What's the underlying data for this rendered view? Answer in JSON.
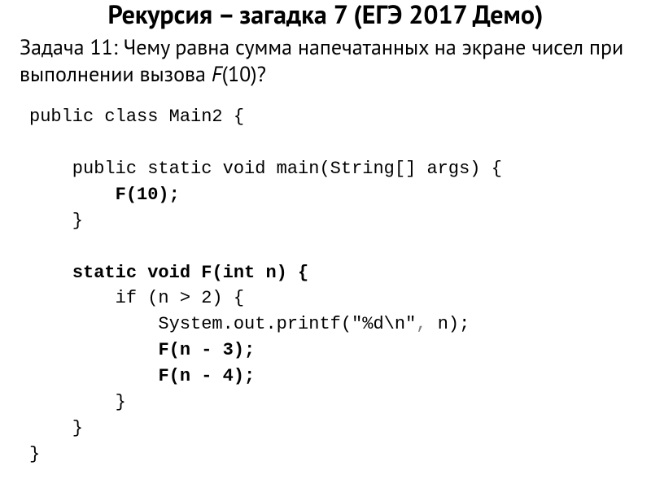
{
  "title": "Рекурсия – загадка 7 (ЕГЭ 2017 Демо)",
  "problem_prefix": "Задача 11: Чему равна сумма напечатанных на экране чисел при выполнении вызова ",
  "problem_fn": "F",
  "problem_suffix": "(10)?",
  "code": {
    "l1": "public class Main2 {",
    "l2": "",
    "l3": "    public static void main(String[] args) {",
    "l4_indent": "        ",
    "l4_bold": "F(10);",
    "l5": "    }",
    "l6": "",
    "l7_indent": "    ",
    "l7_bold": "static void F(int n) {",
    "l8": "        if (n > 2) {",
    "l9": "            System.out.printf(\"%d\\n\"",
    "l9_grey": ", ",
    "l9_tail": "n);",
    "l10_indent": "            ",
    "l10_bold": "F(n - 3);",
    "l11_indent": "            ",
    "l11_bold": "F(n - 4);",
    "l12": "        }",
    "l13": "    }",
    "l14": "}"
  }
}
